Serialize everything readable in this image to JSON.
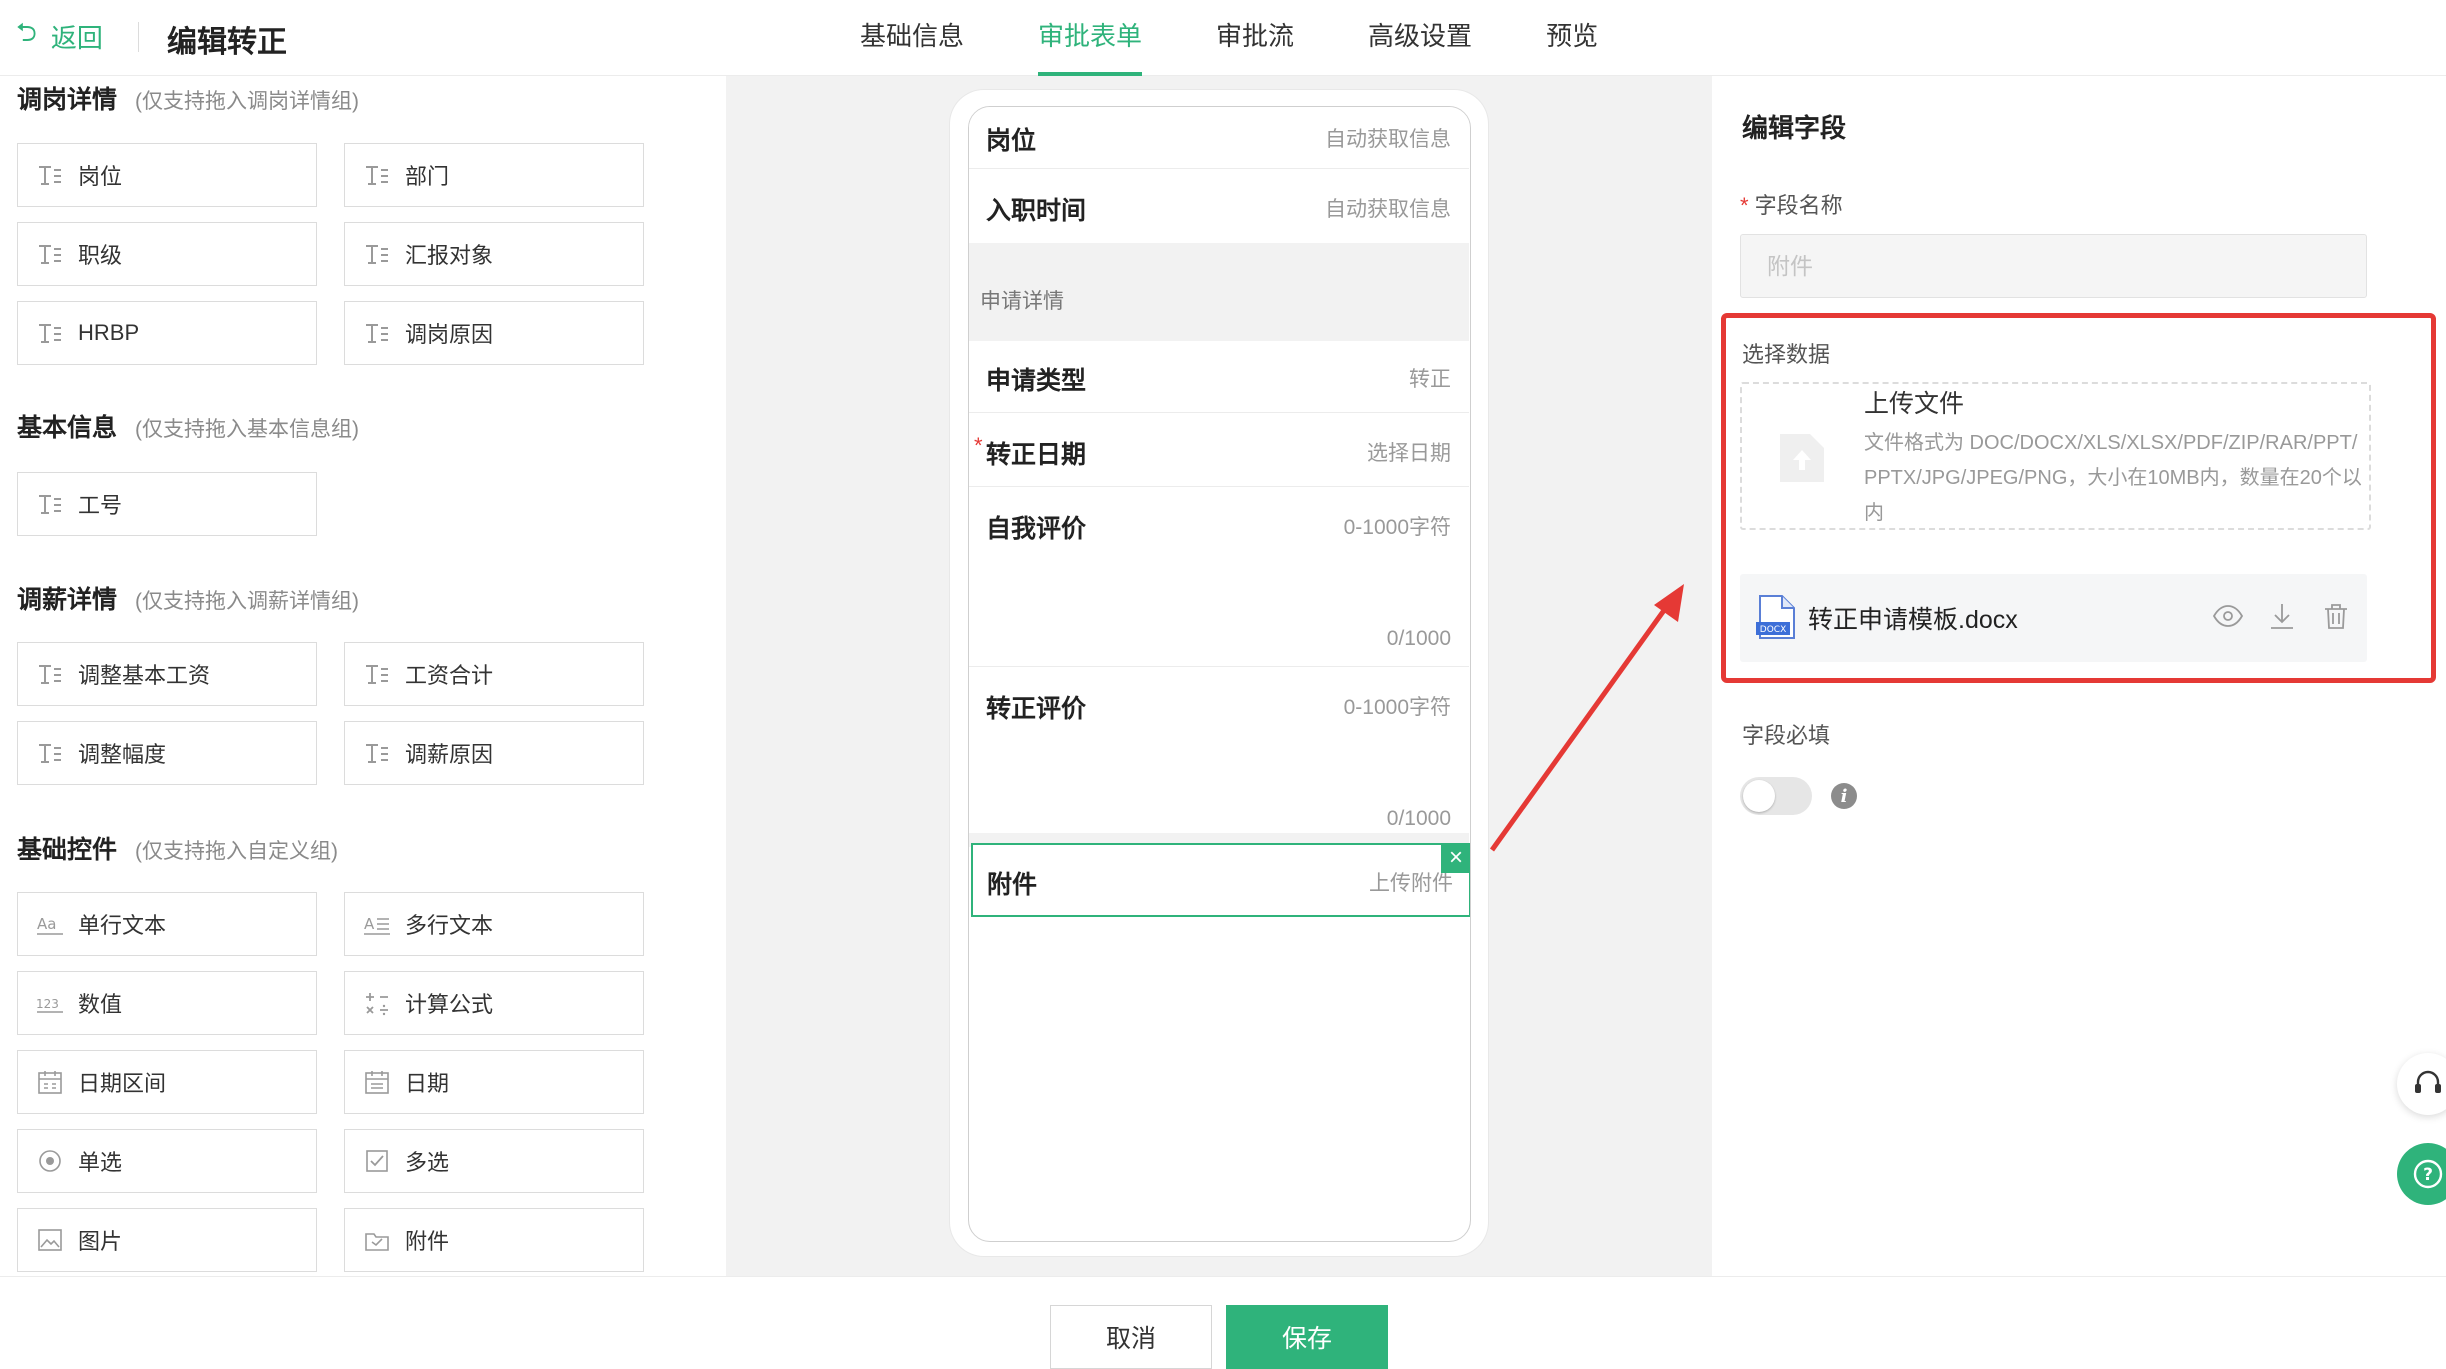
{
  "header": {
    "back_label": "返回",
    "page_title": "编辑转正",
    "tabs": [
      {
        "label": "基础信息",
        "active": false
      },
      {
        "label": "审批表单",
        "active": true
      },
      {
        "label": "审批流",
        "active": false
      },
      {
        "label": "高级设置",
        "active": false
      },
      {
        "label": "预览",
        "active": false
      }
    ]
  },
  "left_panel": {
    "groups": [
      {
        "title": "调岗详情",
        "hint": "(仅支持拖入调岗详情组)",
        "items": [
          "岗位",
          "部门",
          "职级",
          "汇报对象",
          "HRBP",
          "调岗原因"
        ]
      },
      {
        "title": "基本信息",
        "hint": "(仅支持拖入基本信息组)",
        "items": [
          "工号"
        ]
      },
      {
        "title": "调薪详情",
        "hint": "(仅支持拖入调薪详情组)",
        "items": [
          "调整基本工资",
          "工资合计",
          "调整幅度",
          "调薪原因"
        ]
      },
      {
        "title": "基础控件",
        "hint": "(仅支持拖入自定义组)",
        "items": [
          "单行文本",
          "多行文本",
          "数值",
          "计算公式",
          "日期区间",
          "日期",
          "单选",
          "多选",
          "图片",
          "附件"
        ]
      }
    ],
    "basic_control_icons": [
      "text-line-icon",
      "multiline-text-icon",
      "number-icon",
      "formula-icon",
      "date-range-icon",
      "calendar-icon",
      "radio-icon",
      "checkbox-icon",
      "image-icon",
      "attachment-icon"
    ]
  },
  "preview": {
    "rows": [
      {
        "label": "岗位",
        "value": "自动获取信息"
      },
      {
        "label": "入职时间",
        "value": "自动获取信息"
      }
    ],
    "section_title": "申请详情",
    "apply_rows": [
      {
        "label": "申请类型",
        "value": "转正"
      },
      {
        "label": "转正日期",
        "value": "选择日期",
        "required": true
      }
    ],
    "text_areas": [
      {
        "label": "自我评价",
        "placeholder": "0-1000字符",
        "counter": "0/1000"
      },
      {
        "label": "转正评价",
        "placeholder": "0-1000字符",
        "counter": "0/1000"
      }
    ],
    "selected_row": {
      "label": "附件",
      "value": "上传附件"
    }
  },
  "right_panel": {
    "title": "编辑字段",
    "field_name_label": "字段名称",
    "field_name_placeholder": "附件",
    "select_data_label": "选择数据",
    "upload": {
      "title": "上传文件",
      "desc": "文件格式为 DOC/DOCX/XLS/XLSX/PDF/ZIP/RAR/PPT/PPTX/JPG/JPEG/PNG，大小在10MB内，数量在20个以内"
    },
    "file": {
      "name": "转正申请模板.docx",
      "badge": "DOCX"
    },
    "required_label": "字段必填",
    "required_on": false
  },
  "footer": {
    "cancel_label": "取消",
    "save_label": "保存"
  },
  "colors": {
    "accent": "#2fb37b",
    "annotation": "#e53935"
  }
}
